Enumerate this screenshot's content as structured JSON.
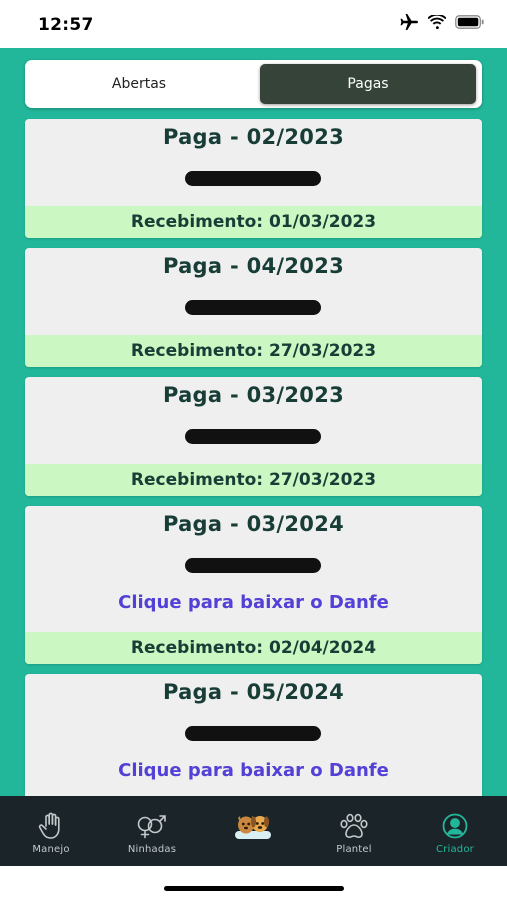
{
  "status_bar": {
    "time": "12:57"
  },
  "segment": {
    "tabs": [
      {
        "label": "Abertas",
        "selected": false
      },
      {
        "label": "Pagas",
        "selected": true
      }
    ]
  },
  "cards": [
    {
      "title": "Paga - 02/2023",
      "link": "",
      "receipt": "Recebimento: 01/03/2023"
    },
    {
      "title": "Paga - 04/2023",
      "link": "",
      "receipt": "Recebimento: 27/03/2023"
    },
    {
      "title": "Paga - 03/2023",
      "link": "",
      "receipt": "Recebimento: 27/03/2023"
    },
    {
      "title": "Paga - 03/2024",
      "link": "Clique para baixar o Danfe",
      "receipt": "Recebimento: 02/04/2024"
    },
    {
      "title": "Paga - 05/2024",
      "link": "Clique para baixar o Danfe",
      "receipt": ""
    }
  ],
  "nav": {
    "items": [
      {
        "label": "Manejo",
        "icon": "hand-icon"
      },
      {
        "label": "Ninhadas",
        "icon": "gender-icon"
      },
      {
        "label": "",
        "icon": "dog-cat-icon"
      },
      {
        "label": "Plantel",
        "icon": "paw-icon"
      },
      {
        "label": "Criador",
        "icon": "user-circle-icon",
        "active": true
      }
    ]
  },
  "colors": {
    "background_green": "#22b79a",
    "selected_tab": "#354339",
    "receipt_bar": "#cbf8c2",
    "link": "#5340d6",
    "nav_bg": "#1b2529"
  }
}
